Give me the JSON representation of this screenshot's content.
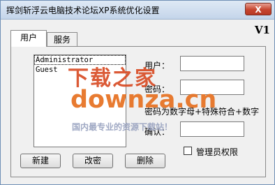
{
  "window": {
    "title": "挥剑斩浮云电脑技术论坛XP系统优化设置",
    "close_label": "X",
    "version": "V1"
  },
  "tabs": [
    {
      "label": "用户"
    },
    {
      "label": "服务"
    }
  ],
  "user_list": [
    "Administrator",
    "Guest"
  ],
  "form": {
    "username_label": "用户：",
    "password_label": "密码：",
    "password_hint": "密码为数字母+特殊符合+数字",
    "confirm_label": "确认：",
    "admin_label": "管理员权限"
  },
  "buttons": {
    "new": "新建",
    "change_password": "改密",
    "delete": "删除"
  },
  "watermark": {
    "cn": "下载之家",
    "en": "downza.cn",
    "sub": "国内最专业的资源下载站！"
  }
}
